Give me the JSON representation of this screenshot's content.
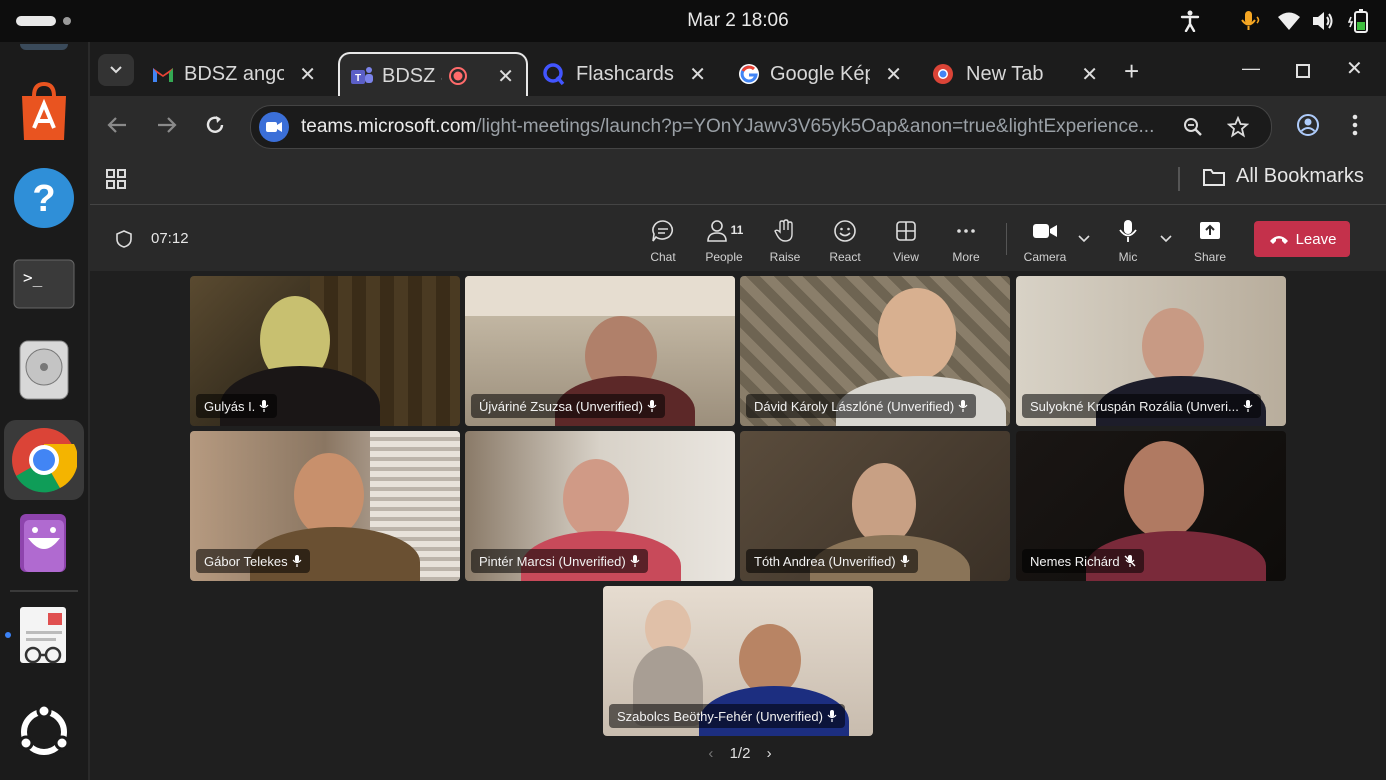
{
  "system": {
    "clock": "Mar 2  18:06"
  },
  "tabs": [
    {
      "title": "BDSZ ango",
      "icon": "gmail-icon"
    },
    {
      "title": "BDSZ ar",
      "icon": "teams-icon",
      "active": true
    },
    {
      "title": "Flashcards",
      "icon": "quizlet-icon"
    },
    {
      "title": "Google Kép",
      "icon": "google-icon"
    },
    {
      "title": "New Tab",
      "icon": "chrome-newtab-icon"
    }
  ],
  "address": {
    "domain": "teams.microsoft.com",
    "path": "/light-meetings/launch?p=YOnYJawv3V65yk5Oap&anon=true&lightExperience..."
  },
  "bookmarks": {
    "all_label": "All Bookmarks"
  },
  "meeting": {
    "timer": "07:12",
    "people_count": "11",
    "controls": {
      "chat": "Chat",
      "people": "People",
      "raise": "Raise",
      "react": "React",
      "view": "View",
      "more": "More",
      "camera": "Camera",
      "mic": "Mic",
      "share": "Share",
      "leave": "Leave"
    },
    "participants": [
      "Gulyás I.",
      "Újváriné Zsuzsa (Unverified)",
      "Dávid Károly Lászlóné (Unverified)",
      "Sulyokné Kruspán Rozália (Unveri...",
      "Gábor Telekes",
      "Pintér Marcsi (Unverified)",
      "Tóth Andrea (Unverified)",
      "Nemes Richárd",
      "Szabolcs Beöthy-Fehér (Unverified)"
    ],
    "page": "1/2"
  },
  "colors": {
    "leave": "#c4314b",
    "chrome_blue": "#3b82f6"
  }
}
